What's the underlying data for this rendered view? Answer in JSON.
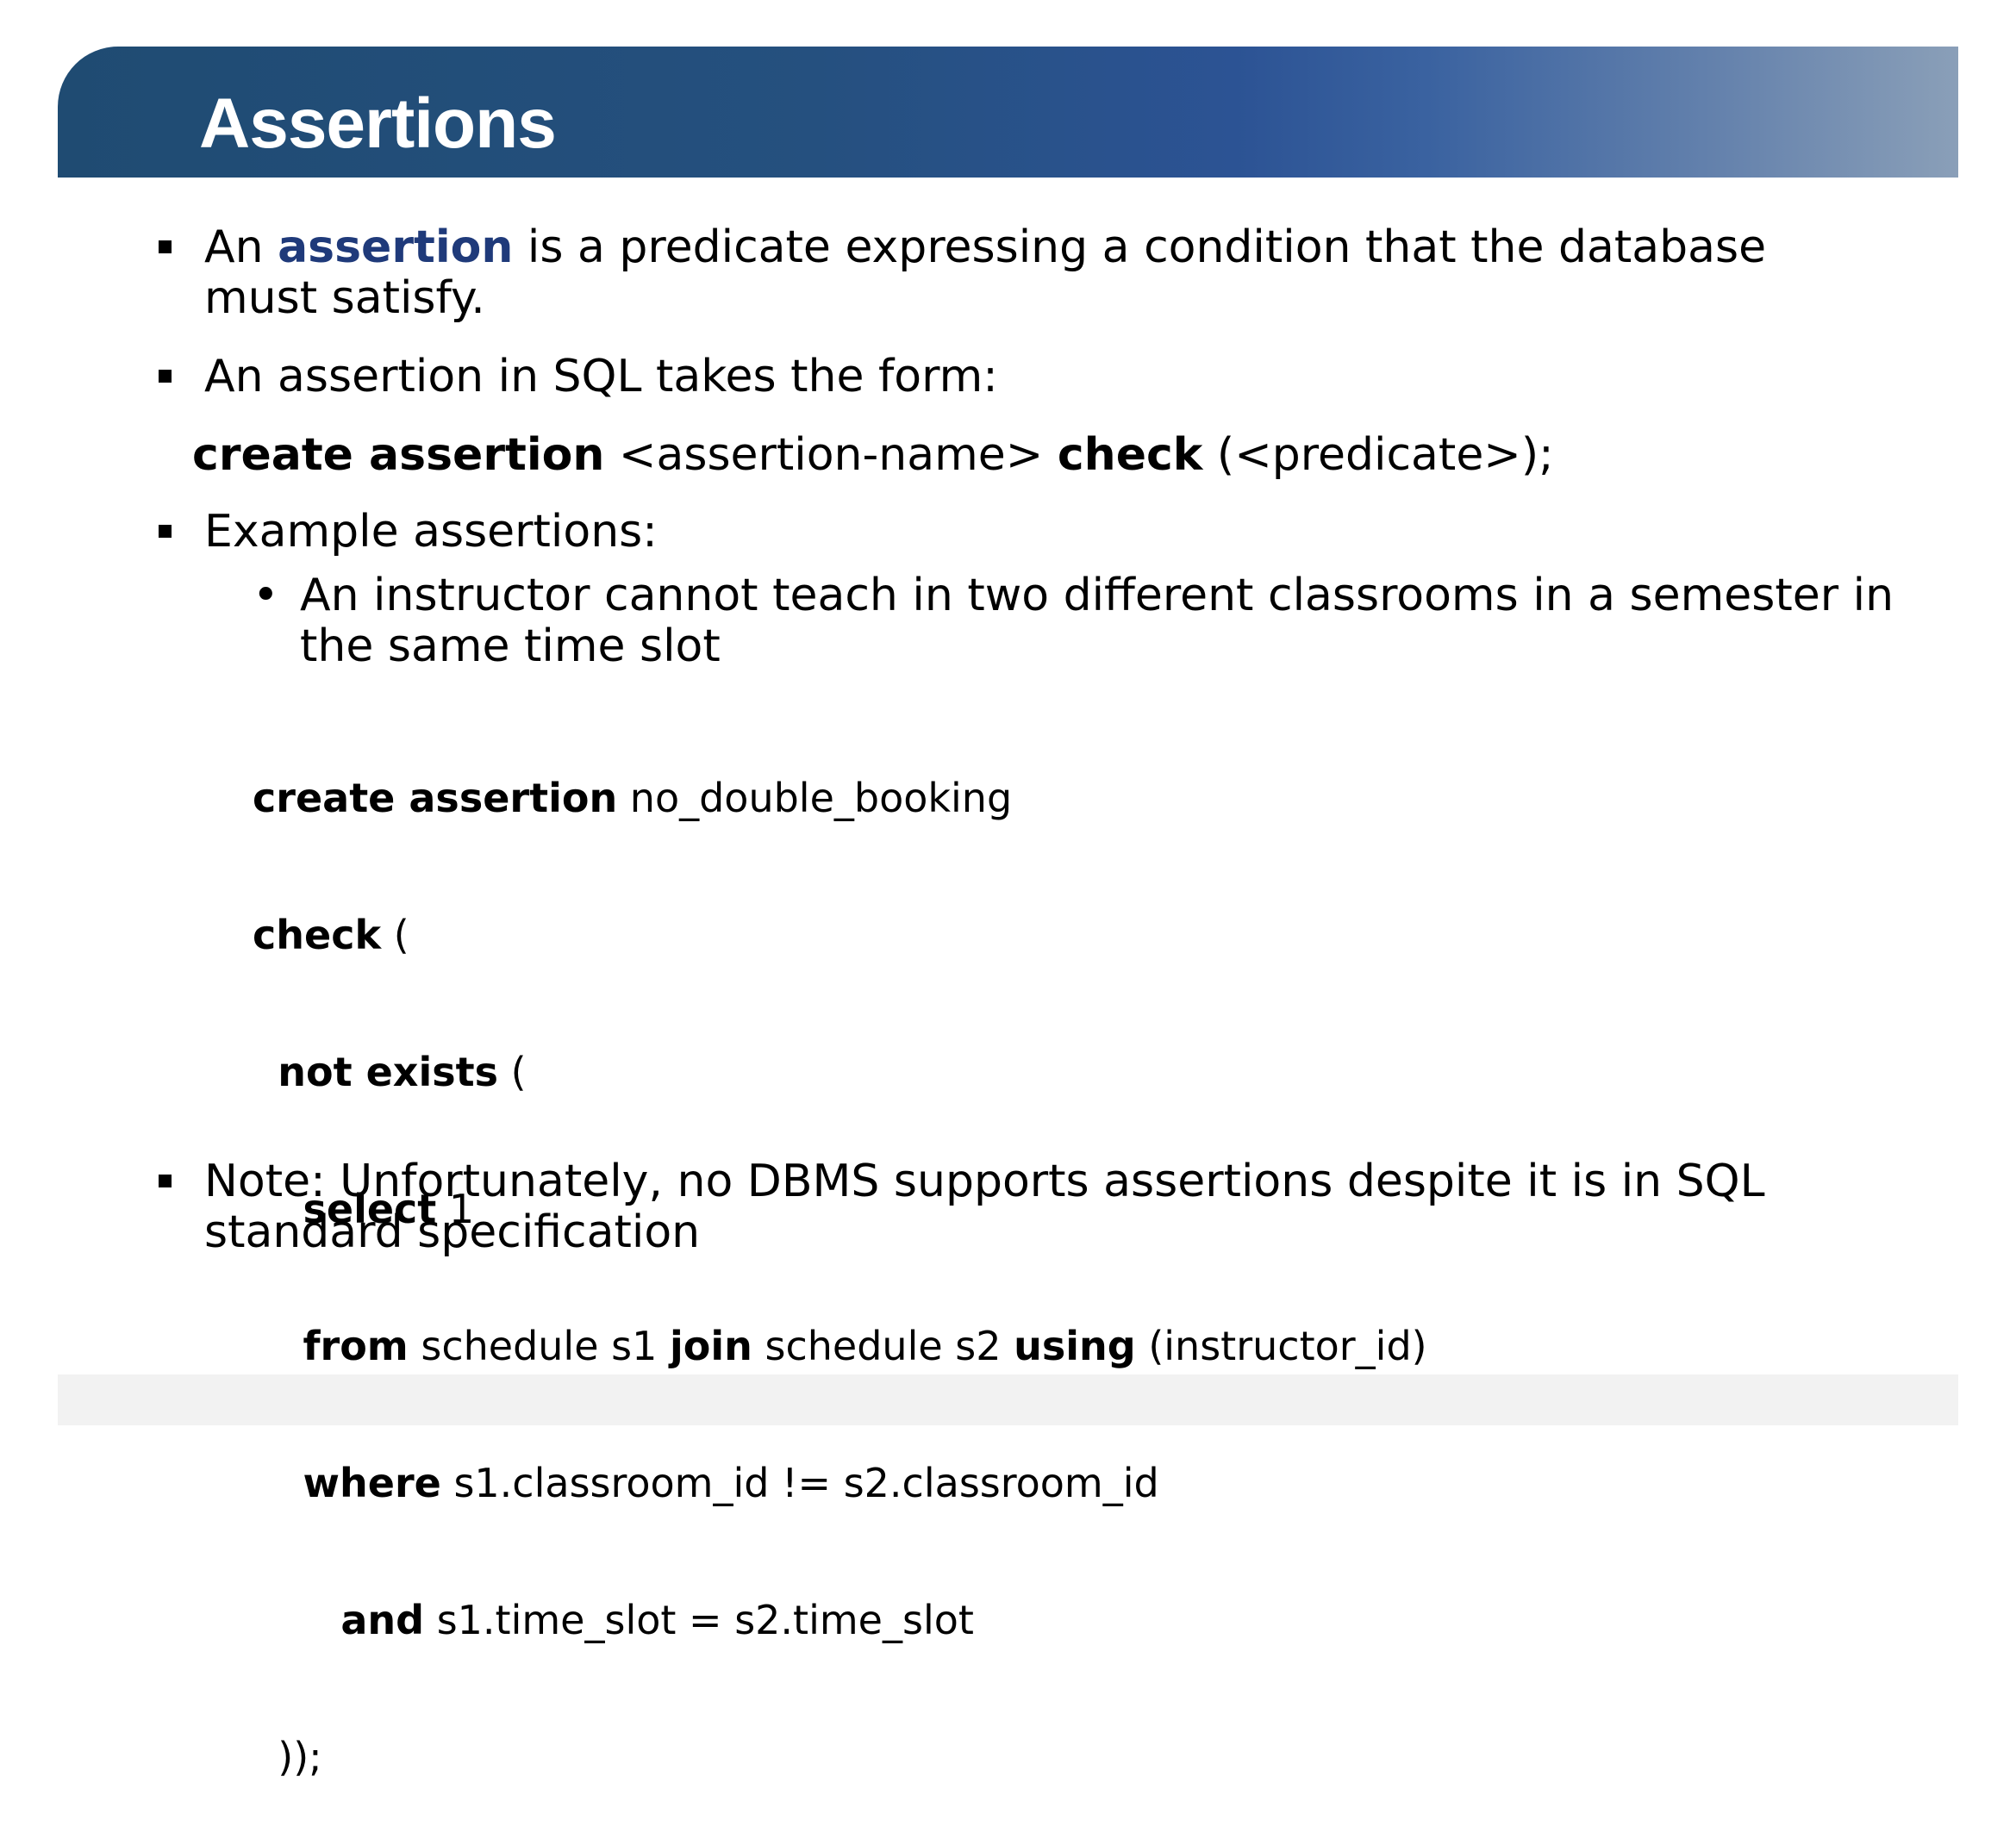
{
  "slide": {
    "title": "Assertions"
  },
  "bullets": {
    "b1": {
      "prefix": "An ",
      "term": "assertion",
      "rest": " is a predicate expressing a condition that the database must satisfy."
    },
    "b2": {
      "text": "An assertion in SQL takes the form:"
    },
    "syntax": {
      "kw1": "create assertion",
      "part1": " <assertion-name> ",
      "kw2": "check",
      "part2": " (<predicate>);"
    },
    "b3": {
      "text": "Example assertions:"
    },
    "sub1": {
      "dot": "•",
      "text": "An instructor cannot teach in two different classrooms in a semester in the same time slot"
    },
    "b4": {
      "text": "Note: Unfortunately, no DBMS supports assertions despite it is in SQL standard specification"
    }
  },
  "code": {
    "l1_kw": "create assertion",
    "l1_rest": " no_double_booking",
    "l2_kw": "check",
    "l2_rest": " (",
    "l3_indent": "  ",
    "l3_kw": "not exists",
    "l3_rest": " (",
    "l4_indent": "    ",
    "l4_kw": "select",
    "l4_rest": " 1",
    "l5_indent": "    ",
    "l5_kw1": "from",
    "l5_part1": " schedule s1 ",
    "l5_kw2": "join",
    "l5_part2": " schedule s2 ",
    "l5_kw3": "using",
    "l5_part3": " (instructor_id)",
    "l6_indent": "    ",
    "l6_kw": "where",
    "l6_rest": " s1.classroom_id != s2.classroom_id",
    "l7_indent": "       ",
    "l7_kw": "and",
    "l7_rest": " s1.time_slot = s2.time_slot",
    "l8_indent": "  ",
    "l8_text": "));"
  },
  "colors": {
    "title_bar_start": "#1f4b72",
    "title_bar_end": "#8a9fb8",
    "term": "#1f3a7a",
    "footer": "#f2f2f2"
  }
}
